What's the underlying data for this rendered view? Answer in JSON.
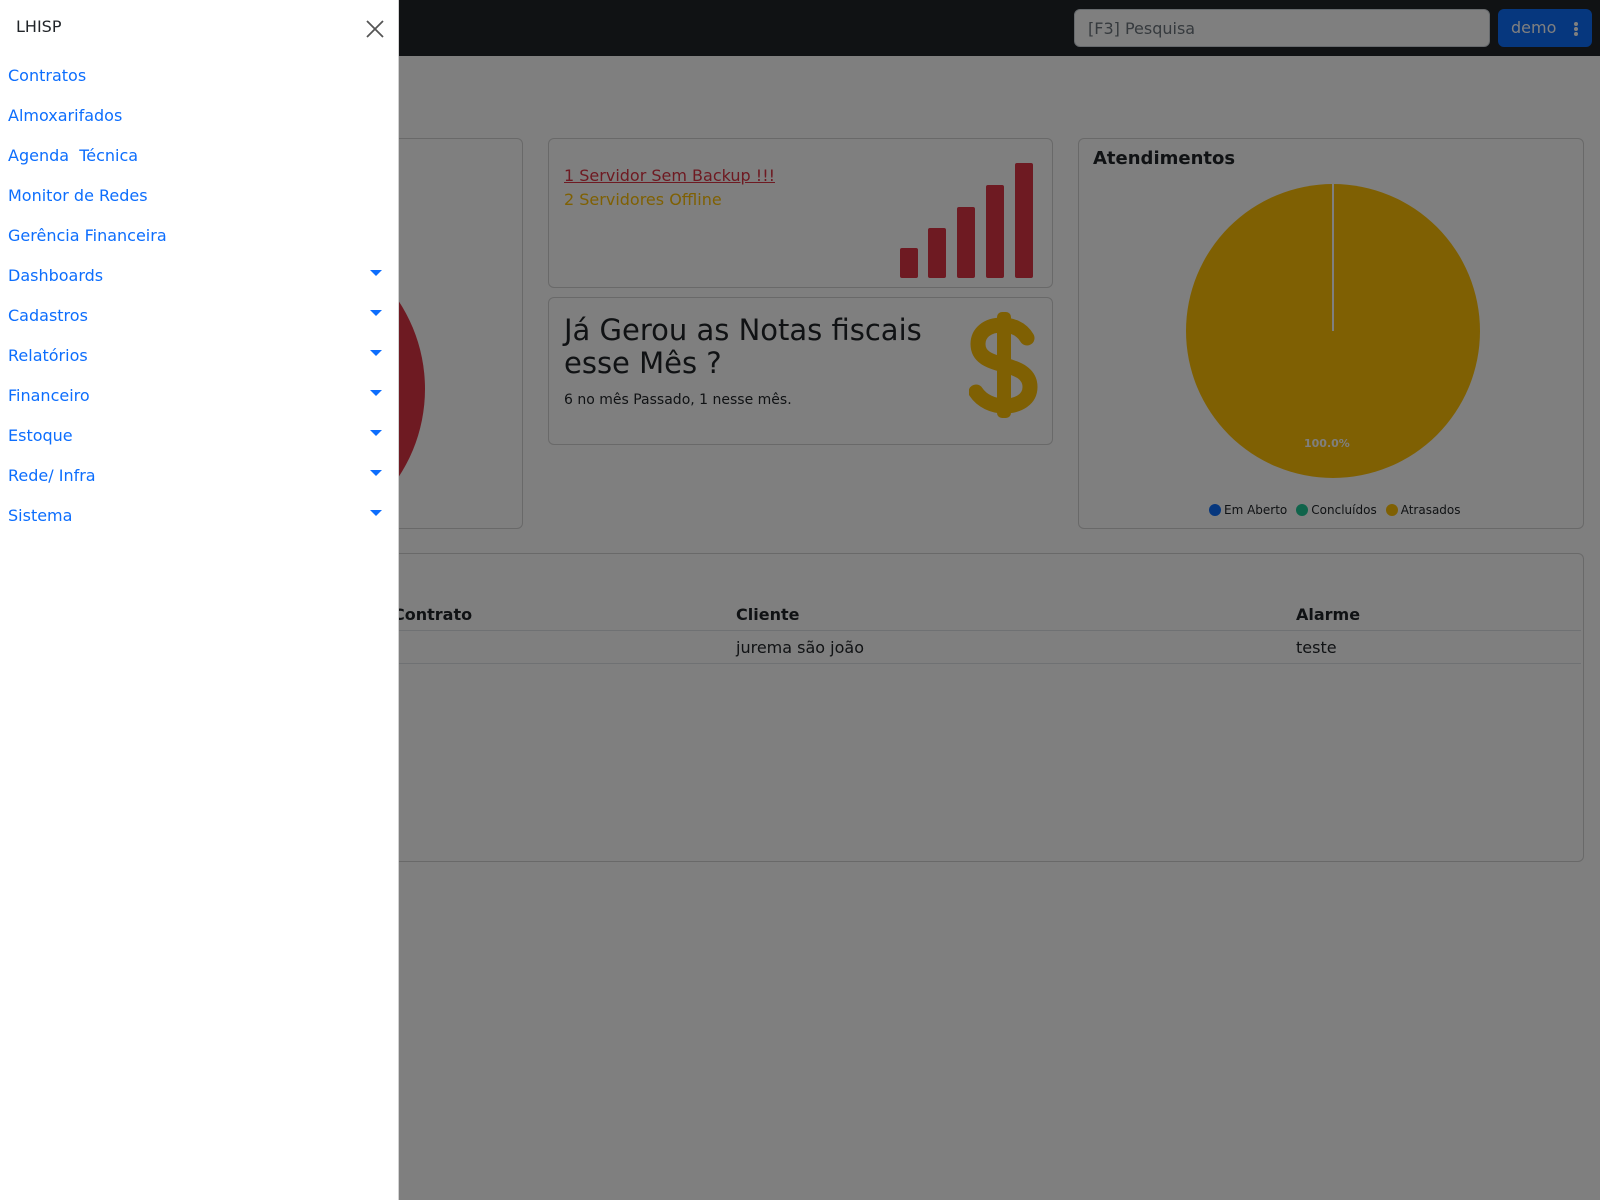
{
  "navbar": {
    "search_placeholder": "[F3] Pesquisa",
    "user_label": "demo"
  },
  "backup_card": {
    "alert_backup": "1 Servidor Sem Backup !!!",
    "alert_offline": "2 Servidores Offline"
  },
  "notas_card": {
    "title": "Já Gerou as Notas fiscais esse Mês ?",
    "subtitle": "6 no mês Passado, 1 nesse mês."
  },
  "atendimentos": {
    "title": "Atendimentos",
    "slice_label": "100.0%",
    "legend": [
      "Em Aberto",
      "Concluídos",
      "Atrasados"
    ],
    "colors": {
      "em_aberto": "#0d6efd",
      "concluidos": "#20c997",
      "atrasados": "#ffc107"
    }
  },
  "table": {
    "headers": [
      "Contrato",
      "Cliente",
      "Alarme"
    ],
    "rows": [
      [
        "",
        "jurema são joão",
        "teste"
      ]
    ]
  },
  "sidebar": {
    "brand": "LHISP",
    "items": [
      {
        "label": "Contratos",
        "dropdown": false
      },
      {
        "label": "Almoxarifados",
        "dropdown": false
      },
      {
        "label": "Agenda  Técnica",
        "dropdown": false
      },
      {
        "label": "Monitor de Redes",
        "dropdown": false
      },
      {
        "label": "Gerência Financeira",
        "dropdown": false
      },
      {
        "label": "Dashboards",
        "dropdown": true
      },
      {
        "label": "Cadastros",
        "dropdown": true
      },
      {
        "label": "Relatórios",
        "dropdown": true
      },
      {
        "label": "Financeiro",
        "dropdown": true
      },
      {
        "label": "Estoque",
        "dropdown": true
      },
      {
        "label": "Rede/ Infra",
        "dropdown": true
      },
      {
        "label": "Sistema",
        "dropdown": true
      }
    ]
  },
  "theme": {
    "primary": "#0d6efd",
    "danger": "#dc3545",
    "warning": "#ffc107",
    "dark": "#212529"
  }
}
